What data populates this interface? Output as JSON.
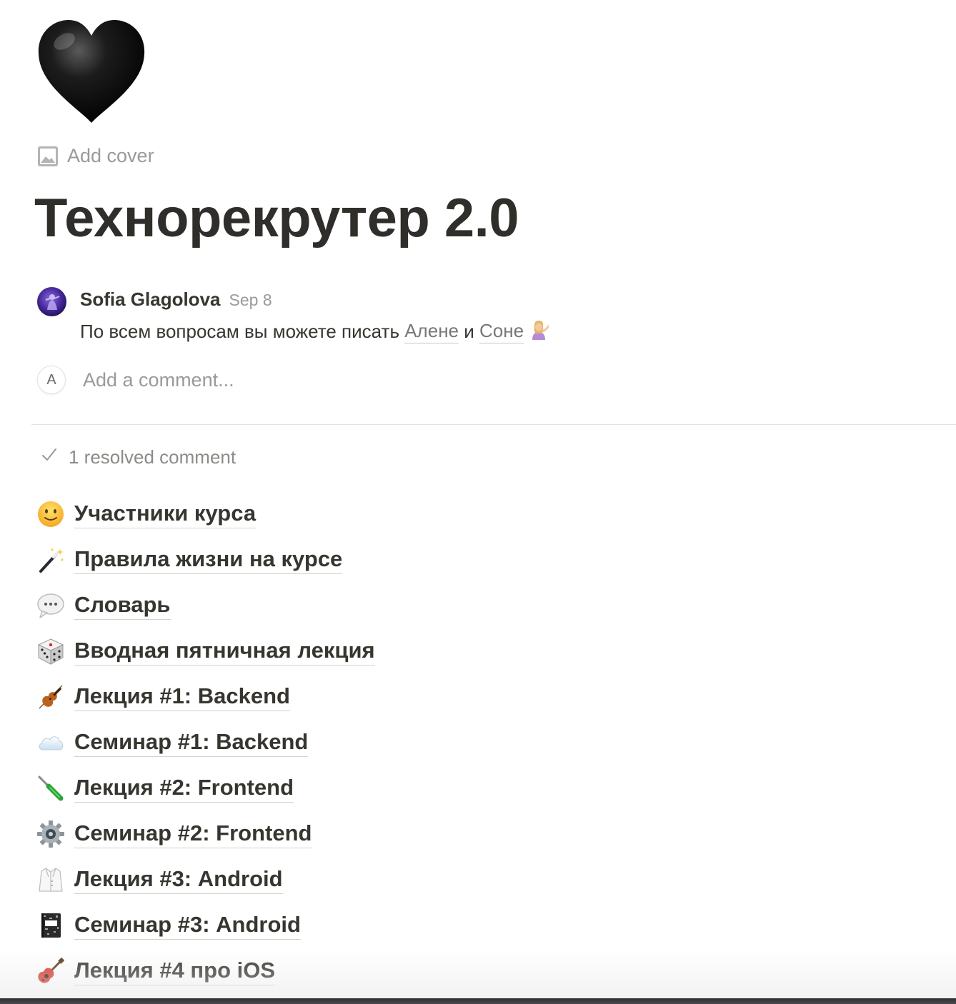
{
  "page": {
    "icon": "black-heart-icon",
    "add_cover_label": "Add cover",
    "title": "Технорекрутер 2.0"
  },
  "comment": {
    "author": "Sofia Glagolova",
    "date": "Sep 8",
    "text_prefix": "По всем вопросам вы можете писать ",
    "mention_1": "Алене",
    "connector": " и ",
    "mention_2": "Соне",
    "emoji": "woman-tipping-hand-icon"
  },
  "add_comment": {
    "avatar_letter": "A",
    "placeholder": "Add a comment..."
  },
  "resolved": {
    "label": "1 resolved comment"
  },
  "subpages": [
    {
      "icon": "slightly-smiling-face-icon",
      "label": "Участники курса"
    },
    {
      "icon": "magic-wand-icon",
      "label": "Правила жизни на курсе"
    },
    {
      "icon": "speech-balloon-icon",
      "label": "Словарь"
    },
    {
      "icon": "game-die-icon",
      "label": "Вводная пятничная лекция"
    },
    {
      "icon": "violin-icon",
      "label": "Лекция #1: Backend"
    },
    {
      "icon": "cloud-icon",
      "label": "Семинар #1: Backend"
    },
    {
      "icon": "screwdriver-icon",
      "label": "Лекция #2: Frontend"
    },
    {
      "icon": "gear-icon",
      "label": "Семинар #2: Frontend"
    },
    {
      "icon": "lab-coat-icon",
      "label": "Лекция #3: Android"
    },
    {
      "icon": "composition-notebook-icon",
      "label": "Семинар #3: Android"
    },
    {
      "icon": "guitar-icon",
      "label": "Лекция #4 про iOS"
    }
  ],
  "colors": {
    "text": "#37352f",
    "muted": "#9b9a97",
    "divider": "#e3e2e0"
  }
}
